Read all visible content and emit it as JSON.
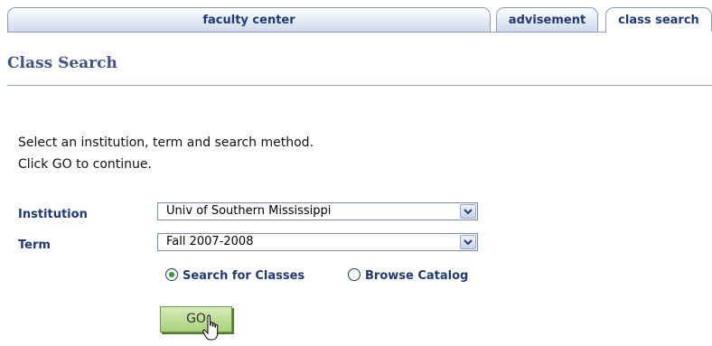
{
  "tabs": [
    {
      "label": "faculty center"
    },
    {
      "label": "advisement"
    },
    {
      "label": "class search"
    }
  ],
  "page_title": "Class Search",
  "instructions": [
    "Select an institution, term and search method.",
    "Click GO to continue."
  ],
  "form": {
    "institution_label": "Institution",
    "institution_value": "Univ of Southern Mississippi",
    "term_label": "Term",
    "term_value": "Fall 2007-2008",
    "radio_search_label": "Search for Classes",
    "radio_browse_label": "Browse Catalog",
    "selected_option": "Search for Classes",
    "go_label": "GO"
  },
  "colors": {
    "tab_text": "#1f3a73",
    "title": "#3f5386",
    "go_button": "#a9d07a"
  }
}
